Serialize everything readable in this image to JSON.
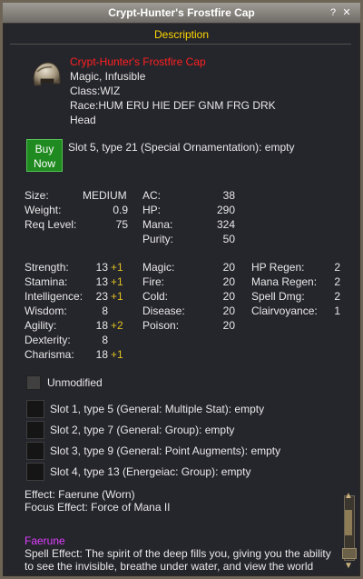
{
  "window": {
    "title": "Crypt-Hunter's Frostfire Cap",
    "help_label": "?",
    "close_label": "✕"
  },
  "description_header": "Description",
  "item": {
    "name": "Crypt-Hunter's Frostfire Cap",
    "line_magic": "Magic, Infusible",
    "line_class": "Class:WIZ",
    "line_race": "Race:HUM ERU HIE DEF GNM FRG DRK",
    "line_slot": "Head",
    "icon": "helmet-icon"
  },
  "buy_button": {
    "line1": "Buy",
    "line2": "Now"
  },
  "ornament_slot": "Slot 5, type 21 (Special Ornamentation): empty",
  "basic_stats": {
    "size_label": "Size:",
    "size_value": "MEDIUM",
    "weight_label": "Weight:",
    "weight_value": "0.9",
    "req_label": "Req Level:",
    "req_value": "75",
    "ac_label": "AC:",
    "ac_value": "38",
    "hp_label": "HP:",
    "hp_value": "290",
    "mana_label": "Mana:",
    "mana_value": "324",
    "purity_label": "Purity:",
    "purity_value": "50"
  },
  "attributes": [
    {
      "label": "Strength:",
      "value": "13",
      "bonus": "+1"
    },
    {
      "label": "Stamina:",
      "value": "13",
      "bonus": "+1"
    },
    {
      "label": "Intelligence:",
      "value": "23",
      "bonus": "+1"
    },
    {
      "label": "Wisdom:",
      "value": "8",
      "bonus": ""
    },
    {
      "label": "Agility:",
      "value": "18",
      "bonus": "+2"
    },
    {
      "label": "Dexterity:",
      "value": "8",
      "bonus": ""
    },
    {
      "label": "Charisma:",
      "value": "18",
      "bonus": "+1"
    }
  ],
  "resists": [
    {
      "label": "Magic:",
      "value": "20"
    },
    {
      "label": "Fire:",
      "value": "20"
    },
    {
      "label": "Cold:",
      "value": "20"
    },
    {
      "label": "Disease:",
      "value": "20"
    },
    {
      "label": "Poison:",
      "value": "20"
    }
  ],
  "mods": [
    {
      "label": "HP Regen:",
      "value": "2"
    },
    {
      "label": "Mana Regen:",
      "value": "2"
    },
    {
      "label": "Spell Dmg:",
      "value": "2"
    },
    {
      "label": "Clairvoyance:",
      "value": "1"
    }
  ],
  "unmodified_label": "Unmodified",
  "aug_slots": [
    "Slot 1, type 5 (General: Multiple Stat): empty",
    "Slot 2, type 7 (General: Group): empty",
    "Slot 3, type 9 (General: Point Augments): empty",
    "Slot 4, type 13 (Energeiac: Group): empty"
  ],
  "effects": {
    "effect": "Effect: Faerune (Worn)",
    "focus": "Focus Effect: Force of Mana II"
  },
  "spell": {
    "name": "Faerune",
    "line1": "Spell Effect: The spirit of the deep fills you, giving you the ability",
    "line2": "to see the invisible, breathe under water, and view the world"
  }
}
